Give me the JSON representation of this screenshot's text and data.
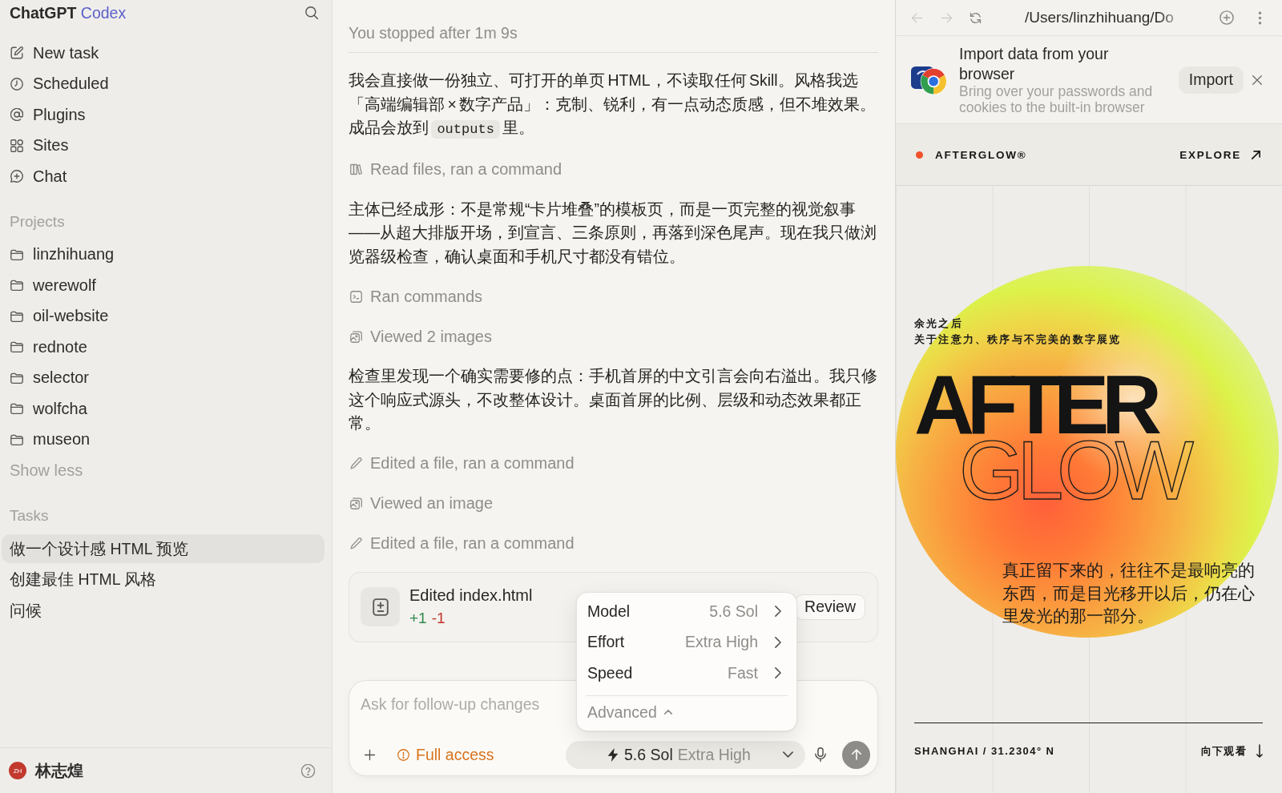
{
  "sidebar": {
    "brand": {
      "name": "ChatGPT",
      "product": "Codex"
    },
    "nav": [
      "New task",
      "Scheduled",
      "Plugins",
      "Sites",
      "Chat"
    ],
    "projects": {
      "heading": "Projects",
      "items": [
        "linzhihuang",
        "werewolf",
        "oil-website",
        "rednote",
        "selector",
        "wolfcha",
        "museon"
      ],
      "toggle": "Show less"
    },
    "tasks": {
      "heading": "Tasks",
      "items": [
        {
          "label": "做一个设计感 HTML 预览",
          "selected": true
        },
        {
          "label": "创建最佳 HTML 风格",
          "selected": false
        },
        {
          "label": "问候",
          "selected": false
        }
      ]
    },
    "user": {
      "initials": "ZH",
      "name": "林志煌"
    }
  },
  "thread": {
    "status": "You stopped after 1m 9s",
    "entries": [
      {
        "kind": "message",
        "parts": [
          {
            "kind": "text",
            "text": "我会直接做一份独立、可打开的单页 HTML，不读取任何 Skill。风格我选「高端编辑部 × 数字产品」：克制、锐利，有一点动态质感，但不堆效果。成品会放到 "
          },
          {
            "kind": "code",
            "text": "outputs"
          },
          {
            "kind": "text",
            "text": " 里。"
          }
        ]
      },
      {
        "kind": "read",
        "label": "Read files, ran a command"
      },
      {
        "kind": "message",
        "parts": [
          {
            "kind": "text",
            "text": "主体已经成形：不是常规“卡片堆叠”的模板页，而是一页完整的视觉叙事——从超大排版开场，到宣言、三条原则，再落到深色尾声。现在我只做浏览器级检查，确认桌面和手机尺寸都没有错位。"
          }
        ]
      },
      {
        "kind": "run",
        "label": "Ran commands"
      },
      {
        "kind": "view",
        "label": "Viewed 2 images"
      },
      {
        "kind": "message",
        "parts": [
          {
            "kind": "text",
            "text": "检查里发现一个确实需要修的点：手机首屏的中文引言会向右溢出。我只修这个响应式源头，不改整体设计。桌面首屏的比例、层级和动态效果都正常。"
          }
        ]
      },
      {
        "kind": "edit",
        "label": "Edited a file, ran a command"
      },
      {
        "kind": "view",
        "label": "Viewed an image"
      },
      {
        "kind": "edit",
        "label": "Edited a file, ran a command"
      }
    ],
    "file_card": {
      "title": "Edited index.html",
      "added": "+1",
      "removed": "-1",
      "action": "Review"
    }
  },
  "composer": {
    "placeholder": "Ask for follow-up changes",
    "access": "Full access",
    "model": "5.6 Sol",
    "effort": "Extra High"
  },
  "model_menu": {
    "items": [
      {
        "label": "Model",
        "value": "5.6 Sol"
      },
      {
        "label": "Effort",
        "value": "Extra High"
      },
      {
        "label": "Speed",
        "value": "Fast"
      }
    ],
    "advanced": "Advanced"
  },
  "browser": {
    "nav_buttons": [
      {
        "kind": "back",
        "disabled": true
      },
      {
        "kind": "forward",
        "disabled": true
      },
      {
        "kind": "reload",
        "disabled": false
      }
    ],
    "address": "/Users/linzhihuang/Do",
    "banner": {
      "title": "Import data from your browser",
      "description": "Bring over your passwords and cookies to the built-in browser",
      "action": "Import"
    },
    "page": {
      "brand": "AFTERGLOW®",
      "nav_link": "EXPLORE",
      "eyebrow": "余光之后",
      "subtitle": "关于注意力、秩序与不完美的数字展览",
      "headline": [
        {
          "kind": "solid",
          "text": "AFTER"
        },
        {
          "kind": "outline",
          "text": "GLOW"
        }
      ],
      "quote": "真正留下来的，往往不是最响亮的东西，而是目光移开以后，仍在心里发光的那一部分。",
      "location": "SHANGHAI / 31.2304° N",
      "scroll_hint": "向下观看"
    }
  }
}
